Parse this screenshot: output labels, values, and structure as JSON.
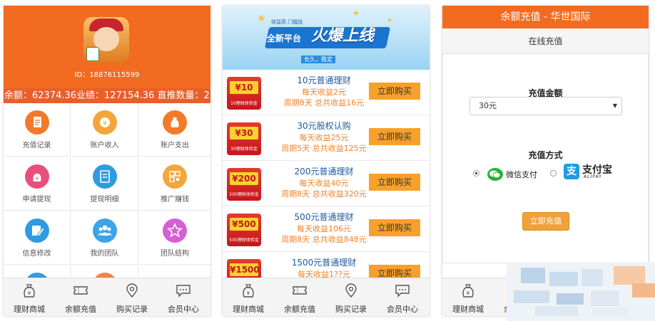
{
  "panel1": {
    "id_text": "ID：18876115599",
    "stats_text": "余额：62374.36业绩：127154.36 直推数量：2",
    "grid": [
      {
        "label": "充值记录",
        "icon": "document-icon",
        "color": "#f27a2a"
      },
      {
        "label": "账户收入",
        "icon": "income-icon",
        "color": "#f5a53a"
      },
      {
        "label": "账户支出",
        "icon": "money-bag-icon",
        "color": "#f27a2a"
      },
      {
        "label": "申请提现",
        "icon": "withdraw-icon",
        "color": "#e8507a"
      },
      {
        "label": "提现明细",
        "icon": "list-icon",
        "color": "#2f9be0"
      },
      {
        "label": "推广赚钱",
        "icon": "qrcode-icon",
        "color": "#f5a53a"
      },
      {
        "label": "信息修改",
        "icon": "edit-icon",
        "color": "#2f9be0"
      },
      {
        "label": "我的团队",
        "icon": "team-icon",
        "color": "#3aa5e8"
      },
      {
        "label": "团队结构",
        "icon": "star-icon",
        "color": "#d65ed6"
      }
    ]
  },
  "tabs": [
    "理财商城",
    "余额充值",
    "购买记录",
    "会员中心"
  ],
  "panel2": {
    "banner": {
      "tag": "收益高 门槛低",
      "platform": "全新平台",
      "headline": "火爆上线",
      "slogan": "长久，稳定"
    },
    "products": [
      {
        "ticket": "¥10",
        "ticket_sub": "10理财体验金",
        "name": "10元普通理财",
        "daily": "每天收益2元",
        "total": "周期8天 总共收益16元",
        "buy": "立即购买"
      },
      {
        "ticket": "¥30",
        "ticket_sub": "30理财体验金",
        "name": "30元股权认购",
        "daily": "每天收益25元",
        "total": "周期5天 总共收益125元",
        "buy": "立即购买"
      },
      {
        "ticket": "¥200",
        "ticket_sub": "200理财体验金",
        "name": "200元普通理财",
        "daily": "每天收益40元",
        "total": "周期8天 总共收益320元",
        "buy": "立即购买"
      },
      {
        "ticket": "¥500",
        "ticket_sub": "500理财体验金",
        "name": "500元普通理财",
        "daily": "每天收益106元",
        "total": "周期8天 总共收益848元",
        "buy": "立即购买"
      },
      {
        "ticket": "¥1500",
        "ticket_sub": "",
        "name": "1500元普通理财",
        "daily": "每天收益1??元",
        "total": "",
        "buy": "立即购买"
      }
    ]
  },
  "panel3": {
    "title": "余额充值 - 华世国际",
    "subtitle": "在线充值",
    "amount_label": "充值金额",
    "amount_value": "30元",
    "method_label": "充值方式",
    "wechat_label": "微信支付",
    "alipay_label": "支付宝",
    "alipay_sub": "ALIPAY",
    "alipay_glyph": "支",
    "submit_label": "立即充值"
  }
}
